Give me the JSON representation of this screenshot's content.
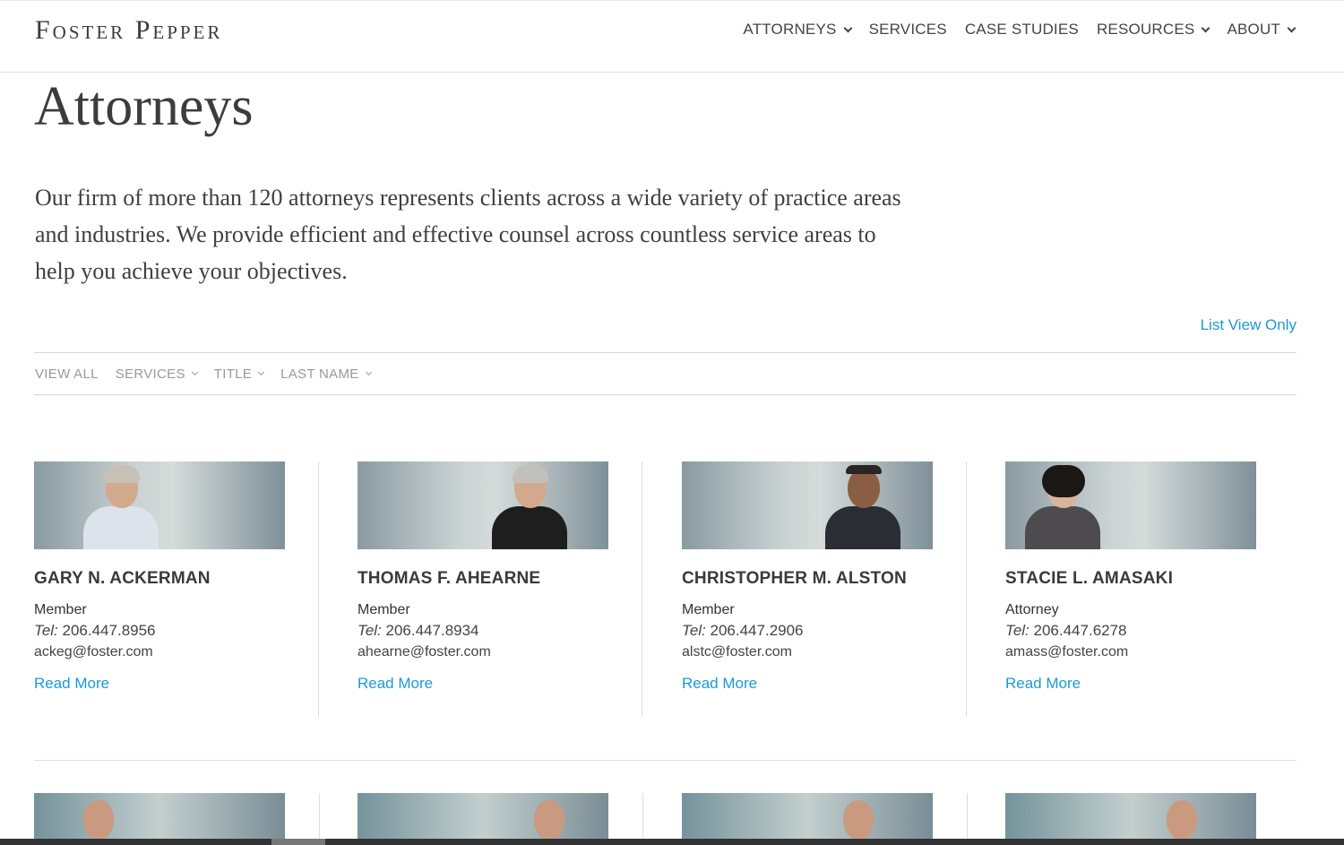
{
  "header": {
    "logo": "Foster Pepper",
    "nav": [
      {
        "label": "ATTORNEYS",
        "dropdown": true
      },
      {
        "label": "SERVICES",
        "dropdown": false
      },
      {
        "label": "CASE STUDIES",
        "dropdown": false
      },
      {
        "label": "RESOURCES",
        "dropdown": true
      },
      {
        "label": "ABOUT",
        "dropdown": true
      }
    ]
  },
  "main": {
    "title": "Attorneys",
    "intro": "Our firm of more than 120 attorneys represents clients across a wide variety of practice areas and industries. We provide efficient and effective counsel across countless service areas to help you achieve your objectives.",
    "list_view_label": "List View Only",
    "filters": {
      "view_all": "VIEW ALL",
      "services": "SERVICES",
      "title": "TITLE",
      "last_name": "LAST NAME"
    },
    "tel_label": "Tel:",
    "attorneys": [
      {
        "name": "GARY N. ACKERMAN",
        "role": "Member",
        "tel": "206.447.8956",
        "email": "ackeg@foster.com",
        "read_more": "Read More"
      },
      {
        "name": "THOMAS F. AHEARNE",
        "role": "Member",
        "tel": "206.447.8934",
        "email": "ahearne@foster.com",
        "read_more": "Read More"
      },
      {
        "name": "CHRISTOPHER M. ALSTON",
        "role": "Member",
        "tel": "206.447.2906",
        "email": "alstc@foster.com",
        "read_more": "Read More"
      },
      {
        "name": "STACIE L. AMASAKI",
        "role": "Attorney",
        "tel": "206.447.6278",
        "email": "amass@foster.com",
        "read_more": "Read More"
      }
    ]
  },
  "colors": {
    "link": "#1a9ad6",
    "text": "#333333",
    "muted": "#999999"
  }
}
